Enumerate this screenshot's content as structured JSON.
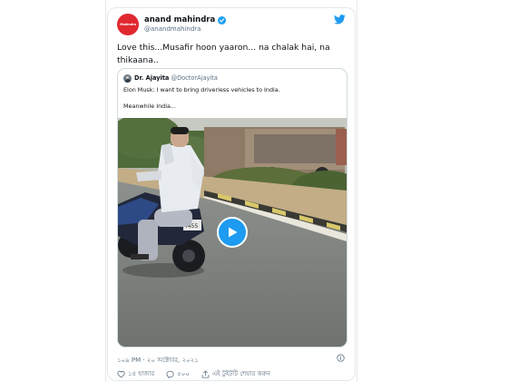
{
  "tweet": {
    "avatar_text": "Mahindra",
    "author_name": "anand mahindra",
    "author_handle": "@anandmahindra",
    "text": "Love this...Musafir hoon yaaron... na chalak hai, na thikaana..",
    "timestamp": "১০৯ PM · ২০ অক্টোবর, ২০২১",
    "likes": "১৪ হাজার",
    "replies": "৫০০",
    "share_label": "এই টুইটটি শেয়ার করুন"
  },
  "quoted_tweet": {
    "author_name": "Dr. Ajayita",
    "author_handle": "@DoctorAjayita",
    "line1": "Elon Musk: I want to bring driverless vehicles to India.",
    "line2": "Meanwhile India...",
    "video_plate": "4455"
  },
  "colors": {
    "accent": "#1d9bf0",
    "avatar_red": "#e0282f"
  }
}
